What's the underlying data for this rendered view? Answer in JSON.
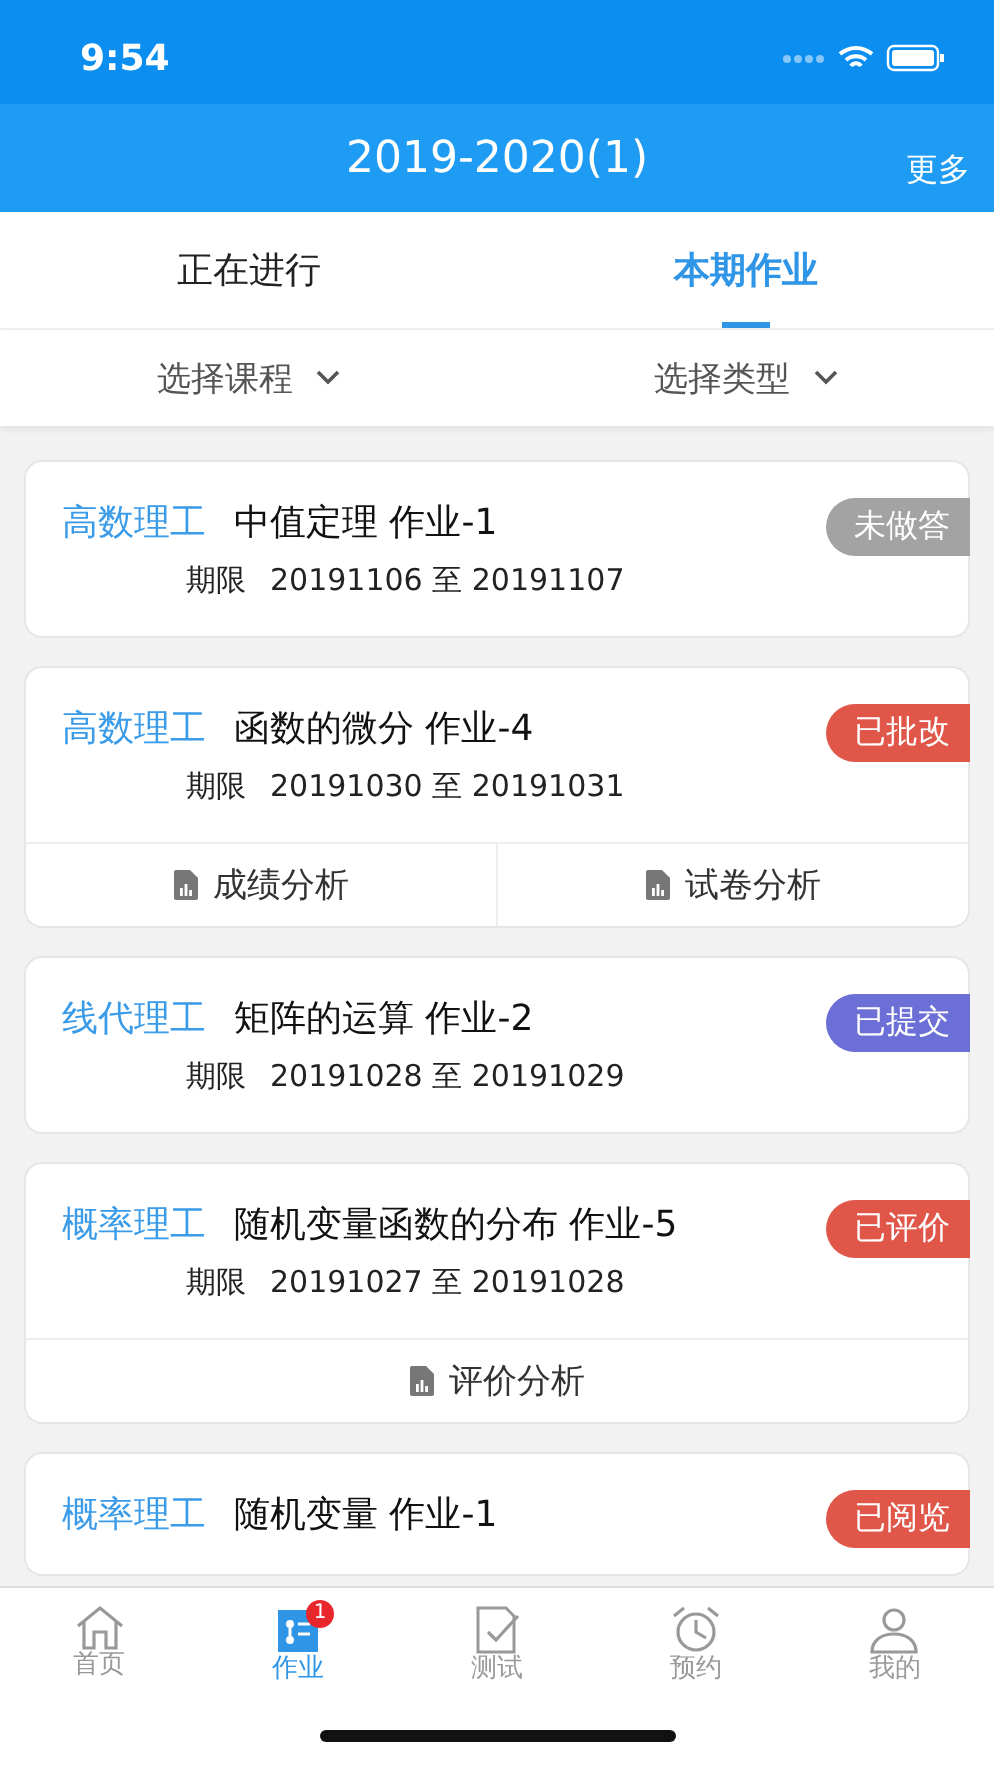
{
  "status_bar": {
    "time": "9:54"
  },
  "header": {
    "title": "2019-2020(1)",
    "action": "更多"
  },
  "tabs": [
    {
      "label": "正在进行",
      "selected": false
    },
    {
      "label": "本期作业",
      "selected": true
    }
  ],
  "filters": [
    {
      "label": "选择课程"
    },
    {
      "label": "选择类型"
    }
  ],
  "assignments": [
    {
      "course": "高数理工",
      "title": "中值定理 作业-1",
      "deadline_label": "期限",
      "deadline": "20191106 至 20191107",
      "status": "未做答",
      "color": "#a3a3a3"
    },
    {
      "course": "高数理工",
      "title": "函数的微分 作业-4",
      "deadline_label": "期限",
      "deadline": "20191030 至 20191031",
      "status": "已批改",
      "color": "#e0574a",
      "actions": [
        "成绩分析",
        "试卷分析"
      ]
    },
    {
      "course": "线代理工",
      "title": "矩阵的运算 作业-2",
      "deadline_label": "期限",
      "deadline": "20191028 至 20191029",
      "status": "已提交",
      "color": "#6b6fd6"
    },
    {
      "course": "概率理工",
      "title": "随机变量函数的分布 作业-5",
      "deadline_label": "期限",
      "deadline": "20191027 至 20191028",
      "status": "已评价",
      "color": "#e0574a",
      "actions": [
        "评价分析"
      ]
    },
    {
      "course": "概率理工",
      "title": "随机变量 作业-1",
      "status": "已阅览",
      "color": "#e0574a"
    }
  ],
  "bottom_nav": [
    {
      "label": "首页",
      "selected": false
    },
    {
      "label": "作业",
      "selected": true,
      "badge": "1"
    },
    {
      "label": "测试",
      "selected": false
    },
    {
      "label": "预约",
      "selected": false
    },
    {
      "label": "我的",
      "selected": false
    }
  ]
}
